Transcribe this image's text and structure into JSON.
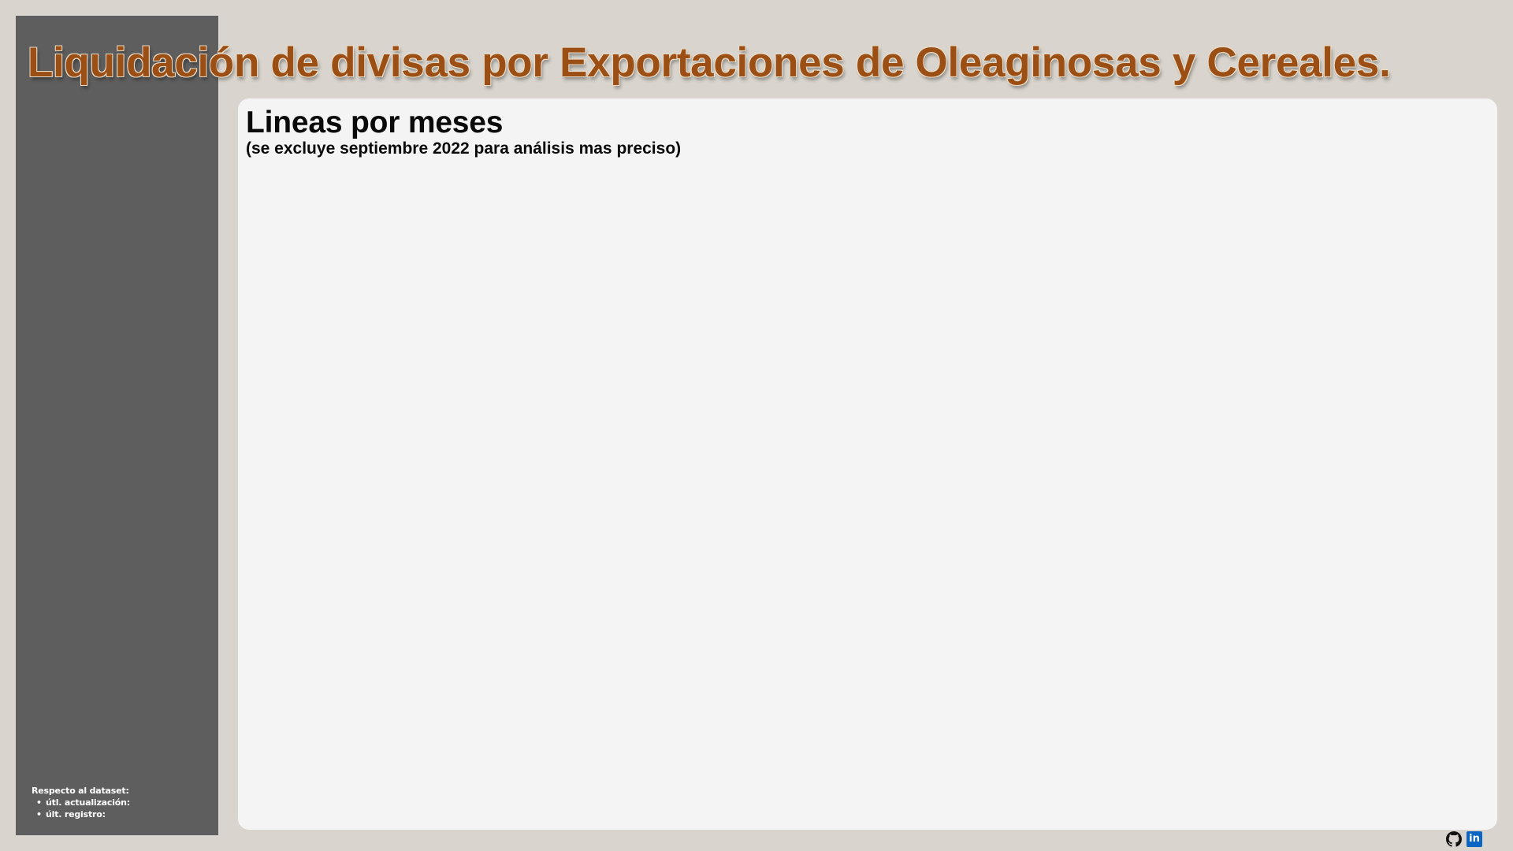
{
  "header": {
    "title": "Liquidación de divisas por Exportaciones de Oleaginosas y Cereales."
  },
  "sidebar": {
    "dataset_heading": "Respecto al dataset:",
    "items": [
      {
        "label": "útl. actualización:"
      },
      {
        "label": "últ. registro:"
      }
    ]
  },
  "main": {
    "heading": "Lineas por meses",
    "subheading": "(se excluye septiembre 2022 para análisis mas preciso)"
  },
  "footer": {
    "icons": [
      "github-icon",
      "linkedin-icon"
    ]
  },
  "colors": {
    "background": "#d9d5ce",
    "sidebar": "#5e5e5e",
    "title": "#9c4f14",
    "panel": "#f4f4f4",
    "linkedin": "#0a66c2"
  }
}
